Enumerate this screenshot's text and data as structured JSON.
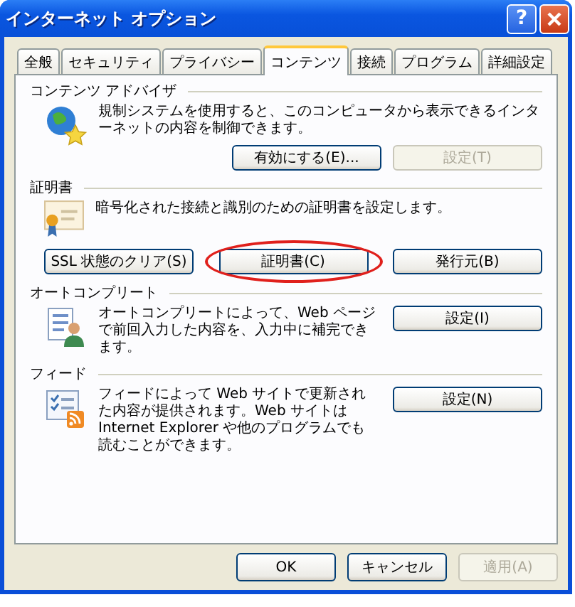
{
  "window": {
    "title": "インターネット オプション",
    "help_button": "?"
  },
  "tabs": [
    {
      "label": "全般",
      "selected": false
    },
    {
      "label": "セキュリティ",
      "selected": false
    },
    {
      "label": "プライバシー",
      "selected": false
    },
    {
      "label": "コンテンツ",
      "selected": true
    },
    {
      "label": "接続",
      "selected": false
    },
    {
      "label": "プログラム",
      "selected": false
    },
    {
      "label": "詳細設定",
      "selected": false
    }
  ],
  "sections": [
    {
      "kind": "advisor",
      "title": "コンテンツ アドバイザ",
      "text": "規制システムを使用すると、このコンピュータから表示できるインターネットの内容を制御できます。",
      "buttons": [
        {
          "label": "有効にする(E)...",
          "disabled": false,
          "circled": false
        },
        {
          "label": "設定(T)",
          "disabled": true,
          "circled": false
        }
      ]
    },
    {
      "kind": "certificate",
      "title": "証明書",
      "text": "暗号化された接続と識別のための証明書を設定します。",
      "buttons": [
        {
          "label": "SSL 状態のクリア(S)",
          "disabled": false,
          "circled": false
        },
        {
          "label": "証明書(C)",
          "disabled": false,
          "circled": true
        },
        {
          "label": "発行元(B)",
          "disabled": false,
          "circled": false
        }
      ]
    },
    {
      "kind": "autocomplete",
      "title": "オートコンプリート",
      "text": "オートコンプリートによって、Web ページで前回入力した内容を、入力中に補完できます。",
      "buttons": [
        {
          "label": "設定(I)",
          "disabled": false,
          "circled": false
        }
      ]
    },
    {
      "kind": "feed",
      "title": "フィード",
      "text": "フィードによって Web サイトで更新された内容が提供されます。Web サイトは Internet Explorer や他のプログラムでも読むことができます。",
      "buttons": [
        {
          "label": "設定(N)",
          "disabled": false,
          "circled": false
        }
      ]
    }
  ],
  "buttons": [
    {
      "label": "OK",
      "disabled": false
    },
    {
      "label": "キャンセル",
      "disabled": false
    },
    {
      "label": "適用(A)",
      "disabled": true
    }
  ]
}
